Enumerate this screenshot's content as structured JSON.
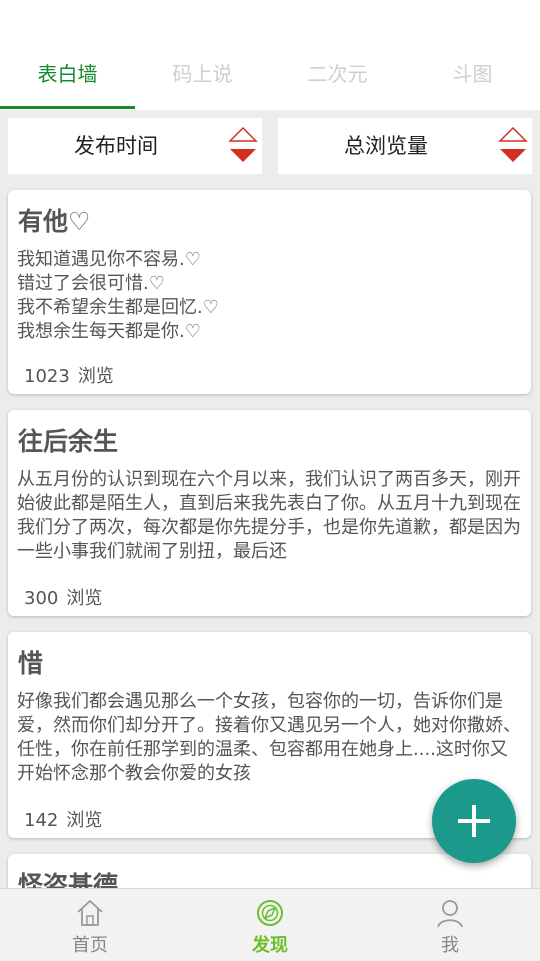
{
  "tabs": [
    {
      "label": "表白墙",
      "active": true
    },
    {
      "label": "码上说",
      "active": false
    },
    {
      "label": "二次元",
      "active": false
    },
    {
      "label": "斗图",
      "active": false
    }
  ],
  "sort": {
    "left_label": "发布时间",
    "right_label": "总浏览量"
  },
  "posts": [
    {
      "title": "有他♡",
      "body": "我知道遇见你不容易.♡\n错过了会很可惜.♡\n我不希望余生都是回忆.♡\n我想余生每天都是你.♡",
      "views": "1023",
      "views_label": "浏览"
    },
    {
      "title": "往后余生",
      "body": "从五月份的认识到现在六个月以来，我们认识了两百多天，刚开始彼此都是陌生人，直到后来我先表白了你。从五月十九到现在 我们分了两次，每次都是你先提分手，也是你先道歉，都是因为一些小事我们就闹了别扭，最后还",
      "views": "300",
      "views_label": "浏览"
    },
    {
      "title": "惜",
      "body": "好像我们都会遇见那么一个女孩，包容你的一切，告诉你们是爱，然而你们却分开了。接着你又遇见另一个人，她对你撒娇、任性，你在前任那学到的温柔、包容都用在她身上....这时你又开始怀念那个教会你爱的女孩",
      "views": "142",
      "views_label": "浏览"
    },
    {
      "title": "怪盗基德"
    }
  ],
  "fab": {
    "icon": "plus-icon"
  },
  "bottom_nav": [
    {
      "label": "首页",
      "icon": "home-icon",
      "active": false
    },
    {
      "label": "发现",
      "icon": "compass-icon",
      "active": true
    },
    {
      "label": "我",
      "icon": "person-icon",
      "active": false
    }
  ],
  "colors": {
    "accent_green": "#178a2e",
    "nav_active": "#6cbf2a",
    "fab": "#1b9a8c",
    "sort_arrow_red": "#d42f1e"
  }
}
